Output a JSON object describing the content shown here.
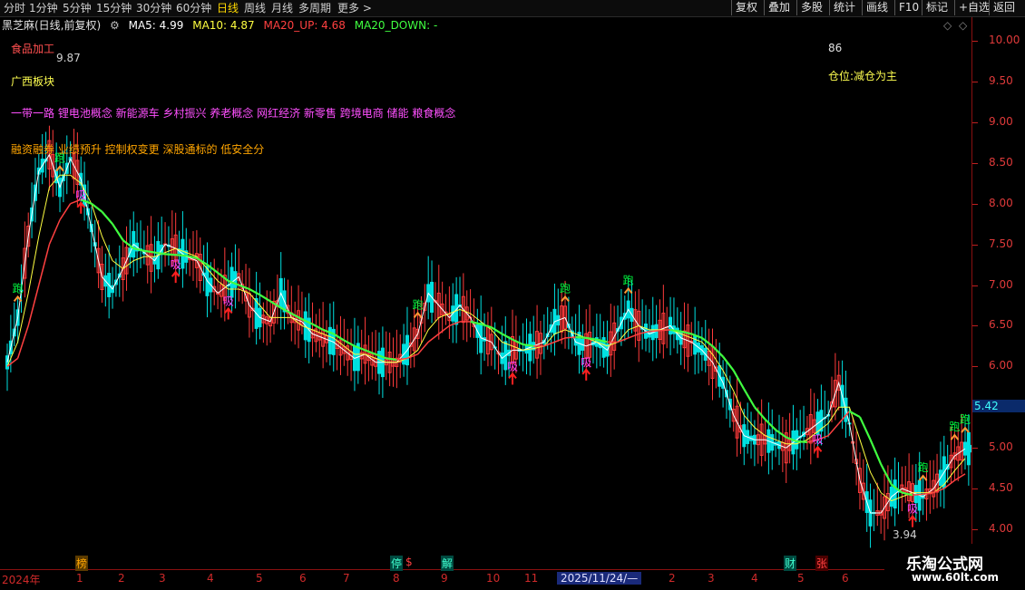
{
  "toolbar": {
    "tabs": [
      "分时",
      "1分钟",
      "5分钟",
      "15分钟",
      "30分钟",
      "60分钟",
      "日线",
      "周线",
      "月线",
      "多周期",
      "更多 >"
    ],
    "active_tab": "日线",
    "right_buttons": [
      "复权",
      "叠加",
      "多股",
      "统计",
      "画线",
      "F10",
      "标记",
      "+自选",
      "返回"
    ]
  },
  "info": {
    "stock": "黑芝麻(日线,前复权)",
    "ma5": "MA5: 4.99",
    "ma10": "MA10: 4.87",
    "ma20_up": "MA20_UP: 4.68",
    "ma20_down": "MA20_DOWN: -"
  },
  "overlay": {
    "sector_food": "食品加工",
    "high_value": "9.87",
    "low_value": "3.94",
    "region": "广西板块",
    "concepts": "一带一路 锂电池概念 新能源车 乡村振兴 养老概念 网红经济 新零售 跨境电商 储能 粮食概念",
    "tags": "融资融券 业绩预升 控制权变更 深股通标的 低安全分",
    "score": "86",
    "position": "仓位:减仓为主",
    "current_price": "5.42"
  },
  "signals": {
    "run": "跑",
    "buy": "吸"
  },
  "events": [
    "榜",
    "停",
    "$",
    "解",
    "财",
    "张"
  ],
  "colors": {
    "up": "#ff3b3b",
    "down": "#00e1e1",
    "ma5": "#ffffff",
    "ma10": "#ffff40",
    "ma20_up": "#ff4040",
    "ma20_down": "#40ff40",
    "run_signal": "#00ff40",
    "buy_signal": "#ff40ff",
    "axis": "#d02a2a"
  },
  "watermark": {
    "title": "乐淘公式网",
    "url": "www.60lt.com"
  },
  "chart_data": {
    "type": "line",
    "ylim": [
      3.8,
      10.1
    ],
    "yticks": [
      4.0,
      4.5,
      5.0,
      5.5,
      6.0,
      6.5,
      7.0,
      7.5,
      8.0,
      8.5,
      9.0,
      9.5,
      10.0
    ],
    "xtick_labels": [
      "2024年",
      "1",
      "2",
      "3",
      "4",
      "5",
      "6",
      "7",
      "8",
      "9",
      "10",
      "11",
      "2025/11/24/—",
      "2",
      "3",
      "4",
      "5",
      "6"
    ],
    "series": [
      {
        "name": "MA5",
        "values": [
          6.05,
          6.6,
          7.6,
          8.4,
          8.6,
          8.2,
          8.55,
          8.3,
          7.7,
          7.1,
          6.95,
          7.2,
          7.5,
          7.4,
          7.3,
          7.5,
          7.45,
          7.35,
          7.3,
          7.05,
          6.9,
          7.0,
          7.1,
          6.75,
          6.6,
          6.55,
          6.9,
          6.6,
          6.55,
          6.4,
          6.35,
          6.3,
          6.2,
          6.1,
          6.15,
          6.05,
          6.05,
          6.05,
          6.2,
          6.4,
          6.9,
          6.75,
          6.6,
          6.75,
          6.6,
          6.35,
          6.3,
          6.1,
          6.2,
          6.2,
          6.25,
          6.3,
          6.55,
          6.6,
          6.3,
          6.25,
          6.3,
          6.2,
          6.45,
          6.7,
          6.5,
          6.4,
          6.45,
          6.5,
          6.35,
          6.3,
          6.2,
          6.05,
          5.8,
          5.4,
          5.15,
          5.1,
          5.1,
          5.05,
          5.0,
          5.1,
          5.2,
          5.3,
          5.4,
          5.8,
          5.3,
          4.6,
          4.2,
          4.2,
          4.4,
          4.5,
          4.45,
          4.4,
          4.5,
          4.7,
          4.9,
          4.99
        ]
      },
      {
        "name": "MA10",
        "values": [
          6.0,
          6.3,
          6.9,
          7.6,
          8.2,
          8.35,
          8.35,
          8.25,
          8.0,
          7.6,
          7.3,
          7.2,
          7.3,
          7.35,
          7.35,
          7.4,
          7.45,
          7.4,
          7.35,
          7.2,
          7.05,
          6.95,
          6.95,
          6.9,
          6.75,
          6.6,
          6.6,
          6.6,
          6.5,
          6.45,
          6.4,
          6.35,
          6.25,
          6.15,
          6.15,
          6.1,
          6.05,
          6.05,
          6.1,
          6.2,
          6.45,
          6.6,
          6.65,
          6.7,
          6.65,
          6.55,
          6.45,
          6.3,
          6.25,
          6.2,
          6.22,
          6.25,
          6.4,
          6.45,
          6.4,
          6.35,
          6.3,
          6.25,
          6.3,
          6.45,
          6.5,
          6.45,
          6.45,
          6.45,
          6.4,
          6.35,
          6.3,
          6.15,
          5.95,
          5.7,
          5.4,
          5.25,
          5.15,
          5.1,
          5.05,
          5.05,
          5.1,
          5.2,
          5.3,
          5.5,
          5.5,
          5.1,
          4.7,
          4.45,
          4.35,
          4.4,
          4.45,
          4.45,
          4.45,
          4.55,
          4.72,
          4.87
        ]
      },
      {
        "name": "MA20_UP",
        "values": [
          6.0,
          6.1,
          6.5,
          7.0,
          7.5,
          7.8,
          8.0,
          8.05,
          8.0,
          7.9,
          7.75,
          7.55,
          7.45,
          7.42,
          7.4,
          7.38,
          7.37,
          7.36,
          7.33,
          7.25,
          7.15,
          7.05,
          7.0,
          6.95,
          6.88,
          6.8,
          6.72,
          6.65,
          6.58,
          6.52,
          6.45,
          6.4,
          6.32,
          6.25,
          6.2,
          6.15,
          6.1,
          6.08,
          6.1,
          6.15,
          6.3,
          6.4,
          6.5,
          6.55,
          6.55,
          6.52,
          6.48,
          6.4,
          6.33,
          6.27,
          6.25,
          6.25,
          6.3,
          6.35,
          6.36,
          6.35,
          6.33,
          6.3,
          6.3,
          6.35,
          6.4,
          6.43,
          6.44,
          6.45,
          6.43,
          6.4,
          6.35,
          6.25,
          6.12,
          5.95,
          5.72,
          5.5,
          5.35,
          5.22,
          5.13,
          5.08,
          5.07,
          5.1,
          5.15,
          5.3,
          5.45,
          5.38,
          5.1,
          4.8,
          4.55,
          4.45,
          4.42,
          4.43,
          4.45,
          4.5,
          4.6,
          4.68
        ]
      },
      {
        "name": "MA20_DOWN",
        "values": [
          6.0,
          6.1,
          6.5,
          7.0,
          7.5,
          7.8,
          8.0,
          8.05,
          8.0,
          7.9,
          7.75,
          7.55,
          7.45,
          7.42,
          7.4,
          7.38,
          7.37,
          7.36,
          7.33,
          7.25,
          7.15,
          7.05,
          7.0,
          6.95,
          6.88,
          6.8,
          6.72,
          6.65,
          6.58,
          6.52,
          6.45,
          6.4,
          6.32,
          6.25,
          6.2,
          6.15,
          6.1,
          6.08,
          6.1,
          6.15,
          6.3,
          6.4,
          6.5,
          6.55,
          6.55,
          6.52,
          6.48,
          6.4,
          6.33,
          6.27,
          6.25,
          6.25,
          6.3,
          6.35,
          6.36,
          6.35,
          6.33,
          6.3,
          6.3,
          6.35,
          6.4,
          6.43,
          6.44,
          6.45,
          6.43,
          6.4,
          6.35,
          6.25,
          6.12,
          5.95,
          5.72,
          5.5,
          5.35,
          5.22,
          5.13,
          5.08,
          5.07,
          5.1,
          5.15,
          5.3,
          5.45,
          5.38,
          5.1,
          4.8,
          4.55,
          4.45,
          4.42,
          4.43,
          4.45,
          4.5,
          4.6,
          4.68
        ]
      }
    ],
    "grid": false,
    "legend": "top-left"
  }
}
